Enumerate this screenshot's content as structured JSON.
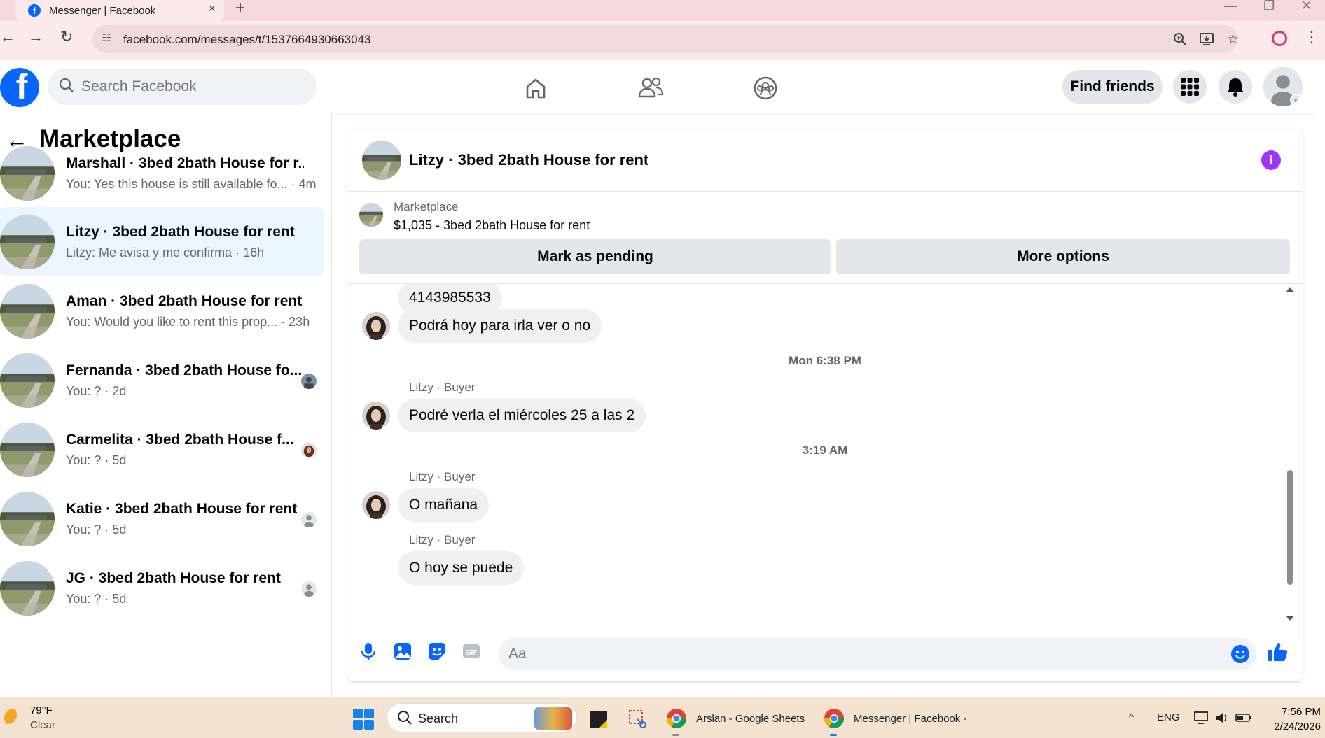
{
  "browser": {
    "tab_title": "Messenger | Facebook",
    "url": "facebook.com/messages/t/1537664930663043"
  },
  "header": {
    "search_placeholder": "Search Facebook",
    "find_friends": "Find friends"
  },
  "sidebar": {
    "title": "Marketplace",
    "conversations": [
      {
        "name": "Marshall · 3bed 2bath House for r...",
        "snippet": "You: Yes this house is still available fo... · 4m",
        "active": false
      },
      {
        "name": "Litzy · 3bed 2bath House for rent",
        "snippet": "Litzy: Me avisa y me confirma · 16h",
        "active": true
      },
      {
        "name": "Aman · 3bed 2bath House for rent",
        "snippet": "You: Would you like to rent this prop... · 23h",
        "active": false
      },
      {
        "name": "Fernanda · 3bed 2bath House fo...",
        "snippet": "You: ? · 2d",
        "active": false
      },
      {
        "name": "Carmelita · 3bed 2bath House f...",
        "snippet": "You: ? · 5d",
        "active": false
      },
      {
        "name": "Katie · 3bed 2bath House for rent",
        "snippet": "You: ? · 5d",
        "active": false
      },
      {
        "name": "JG · 3bed 2bath House for rent",
        "snippet": "You: ? · 5d",
        "active": false
      }
    ]
  },
  "chat": {
    "title": "Litzy · 3bed 2bath House for rent",
    "listing_source": "Marketplace",
    "listing_title": "$1,035 - 3bed 2bath House for rent",
    "mark_pending": "Mark as pending",
    "more_options": "More options",
    "messages": {
      "m1": "4143985533",
      "m2": "Podrá hoy para irla ver o no",
      "t1": "Mon 6:38 PM",
      "s1": "Litzy · Buyer",
      "m3": "Podré verla el miércoles 25 a las 2",
      "t2": "3:19 AM",
      "s2": "Litzy · Buyer",
      "m4": "O mañana",
      "s3": "Litzy · Buyer",
      "m5": "O hoy se puede"
    },
    "composer_placeholder": "Aa"
  },
  "taskbar": {
    "temp": "79°F",
    "condition": "Clear",
    "search": "Search",
    "app1": "Arslan - Google Sheets",
    "app2": "Messenger | Facebook -",
    "lang": "ENG",
    "time": "7:56 PM",
    "date": "2/24/2026"
  },
  "colors": {
    "fb_blue": "#0866ff",
    "active_row": "#ebf5ff",
    "info_purple": "#a033ff",
    "bubble_gray": "#f0f0f0"
  }
}
